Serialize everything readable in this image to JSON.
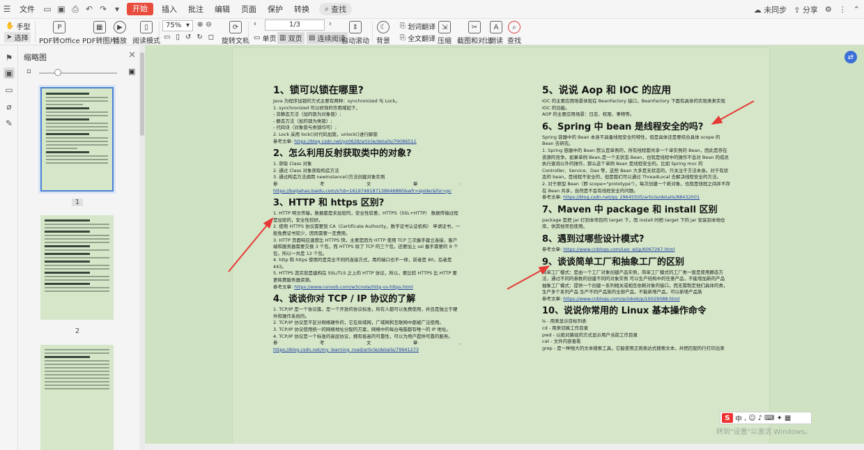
{
  "menubar": {
    "file_label": "文件",
    "tabs": [
      "开始",
      "插入",
      "批注",
      "编辑",
      "页面",
      "保护",
      "转换"
    ],
    "search_label": "查找",
    "sync_label": "未同步",
    "share_label": "分享"
  },
  "ribbon": {
    "hand": "手型",
    "select": "选择",
    "pdf_to_office": "PDF转Office",
    "pdf_to_image": "PDF转图片",
    "play": "播放",
    "read_mode": "阅读模式",
    "zoom_value": "75%",
    "rotate": "旋转文档",
    "page_value": "1/3",
    "single_page": "单页",
    "double_page": "双页",
    "continuous": "连续阅读",
    "auto_scroll": "自动滚动",
    "background": "背景",
    "word_translate": "划词翻译",
    "full_translate": "全文翻译",
    "compress": "压缩",
    "screenshot": "截图和对比",
    "read_aloud": "朗读",
    "find": "查找"
  },
  "thumbnails": {
    "title": "缩略图",
    "pages": [
      "1",
      "2"
    ]
  },
  "document": {
    "left": [
      {
        "type": "h",
        "text": "1、锁可以锁在哪里?"
      },
      {
        "type": "p",
        "text": "Java 为程序加锁的方式主要有两种：synchronized 与 Lock。"
      },
      {
        "type": "p",
        "text": "1. synchronized 可以修饰的作用域如下，"
      },
      {
        "type": "p",
        "text": "- 非静态方法（加的锁为对象锁）;"
      },
      {
        "type": "p",
        "text": "- 静态方法（加的锁为类锁）;"
      },
      {
        "type": "p",
        "text": "- 代码块（对象锁与类锁均可）;"
      },
      {
        "type": "p",
        "text": "2. Lock 采用 lock()对代码加锁，unlock()进行解锁"
      },
      {
        "type": "r",
        "label": "参考文章:",
        "link": "https://blog.csdn.net/yx0628/article/details/79086511"
      },
      {
        "type": "h",
        "text": "2、怎么利用反射获取类中的对象?"
      },
      {
        "type": "p",
        "text": "1. 获取 Class 对象"
      },
      {
        "type": "p",
        "text": "2. 通过 Class 对象获取构造方法"
      },
      {
        "type": "p",
        "text": "3. 通过构造方法调用 newInstance()方法创建对象实例"
      },
      {
        "type": "j",
        "parts": [
          "参",
          "考",
          "文",
          "章",
          ":"
        ]
      },
      {
        "type": "l",
        "link": "https://baijiahao.baidu.com/s?id=1619748187138646880&wfr=spider&for=pc"
      },
      {
        "type": "h",
        "text": "3、HTTP 和 https 区别?"
      },
      {
        "type": "p",
        "text": "1. HTTP 明文传输，数据都是未加密的，安全性较差，HTTPS（SSL+HTTP） 数据传输过程是加密的，安全性较好。"
      },
      {
        "type": "p",
        "text": "2. 使用 HTTPS 协议需要到 CA（Certificate Authority，数字证书认证机构） 申请证书，一般免费证书较少，因而需要一定费用。"
      },
      {
        "type": "p",
        "text": "3. HTTP 页面响应速度比 HTTPS 快，主要是因为 HTTP 使用 TCP 三次握手建立连接，客户端和服务器需要交换 3 个包，而 HTTPS 除了 TCP 的三个包，还要加上 ssl 握手需要的 9 个包，所以一共是 12 个包。"
      },
      {
        "type": "p",
        "text": "4. http 和 https 使用的是完全不同的连接方式，用的端口也不一样，前者是 80，后者是 443。"
      },
      {
        "type": "p",
        "text": "5. HTTPS 其实就是建构在 SSL/TLS 之上的 HTTP 协议，所以，要比较 HTTPS 比 HTTP 要更耗费服务器资源。"
      },
      {
        "type": "r",
        "label": "参考文章:",
        "link": "https://www.runoob.com/w3cnote/http-vs-https.html"
      },
      {
        "type": "h",
        "text": "4、谈谈你对 TCP / IP 协议的了解"
      },
      {
        "type": "p",
        "text": "1. TCP/IP 是一个协议簇，是一个开放的协议标准，所有人都可以免费使用，并且是独立于硬件和操作系统的。"
      },
      {
        "type": "p",
        "text": "2. TCP/IP 协议是不区分网络硬件的，它在局域网，广域网和互联网中都被广泛使用。"
      },
      {
        "type": "p",
        "text": "3. TCP/IP 协议使用统一的网络地址分配的方案，网络中的每台电脑都有唯一的 IP 地址。"
      },
      {
        "type": "p",
        "text": "4. TCP/IP 协议是一个标准的高层协议，拥有极高的可靠性，可以为用户提供可靠的服务。"
      },
      {
        "type": "j",
        "parts": [
          "参",
          "考",
          "文",
          "章",
          ","
        ]
      },
      {
        "type": "l",
        "link": "https://blog.csdn.net/my_learning_road/article/details/79941273"
      }
    ],
    "right": [
      {
        "type": "h",
        "text": "5、说说 Aop 和 IOC 的应用"
      },
      {
        "type": "p",
        "text": "IOC 的主要应用场景体现在 BeanFactory 接口，BeanFactory 下面有具体的实现类来实现 IOC 的功能。"
      },
      {
        "type": "p",
        "text": "AOP 的主要应用场景：日志、权限、事物等。"
      },
      {
        "type": "h",
        "text": "6、Spring 中 bean 是线程安全的吗?"
      },
      {
        "type": "p",
        "text": "Spring 容器中的 Bean 本身不具备线程安全的特性，但是具体还是要结合具体 scope 的 Bean 去研究。"
      },
      {
        "type": "p",
        "text": "1. Spring 容器中的 Bean 默认是单例的，所有线程都共享一个单实例的 Bean，因此是存在资源的竞争。如果单例 Bean,是一个无状态 Bean，也就是线程中的操作不会对 Bean 的成员执行查询以外的操作，那么这个单例 Bean 是线程安全的。比如 Spring mvc 的 Controller、Service、Dao 等，这些 Bean 大多是无状态的，只关注于方法本身。对于有状态的 bean，是线程不安全的，但是我们可以通过 ThreadLocal 去解决线程安全的方法。"
      },
      {
        "type": "p",
        "text": "2. 对于原型 Bean（即 scope=\"prototype\"），每次创建一个新对象，也就是线程之间并不存在 Bean 共享，自然是不会有线程安全的问题。"
      },
      {
        "type": "r",
        "label": "参考文章:",
        "link": "https://blog.csdn.net/qq_29645505/article/details/88432001"
      },
      {
        "type": "h",
        "text": "7、Maven 中 package 和 install 区别"
      },
      {
        "type": "p",
        "text": "package 是把 jar 打到本项目的 target 下，而 install 时把 target 下的 jar 安装到本地仓库，供其他项目使用。"
      },
      {
        "type": "h",
        "text": "8、遇到过哪些设计模式?"
      },
      {
        "type": "r",
        "label": "参考文章:",
        "link": "https://www.cnblogs.com/Leo_wl/p/6067267.html"
      },
      {
        "type": "h",
        "text": "9、谈谈简单工厂和抽象工厂的区别"
      },
      {
        "type": "p",
        "text": "简单工厂模式：是由一个工厂对象创建产品实例，简单工厂模式的工厂类一般是使用静态方法，通过不同的参数的创建不同的对象实例 可以生产结构中的任意产品，不能增加新的产品"
      },
      {
        "type": "p",
        "text": "抽象工厂模式：提供一个创建一系列相关或相互依赖对象的接口，而无需制定他们具体的类，生产多个系列产品 生产不同产品族的全部产品，不能新增产品，可以新增产品族"
      },
      {
        "type": "r",
        "label": "参考文章:",
        "link": "https://www.cnblogs.com/qclokok/p/10029088.html"
      },
      {
        "type": "h",
        "text": "10、说说你常用的 Linux 基本操作命令"
      },
      {
        "type": "p",
        "text": "ls - 用来显示目标列表"
      },
      {
        "type": "p",
        "text": "cd - 用来切换工作目录"
      },
      {
        "type": "p",
        "text": "pwd - 以绝对路径的方式显示用户当前工作目录"
      },
      {
        "type": "p",
        "text": "cat - 文件内容查看"
      },
      {
        "type": "p",
        "text": "grep - 是一种强大的文本搜索工具，它能使用正则表达式搜索文本，并把匹配的行打印出来"
      }
    ]
  },
  "overlay": {
    "ime_label": "中",
    "watermark": "转到\"设置\"以激活 Windows。"
  }
}
